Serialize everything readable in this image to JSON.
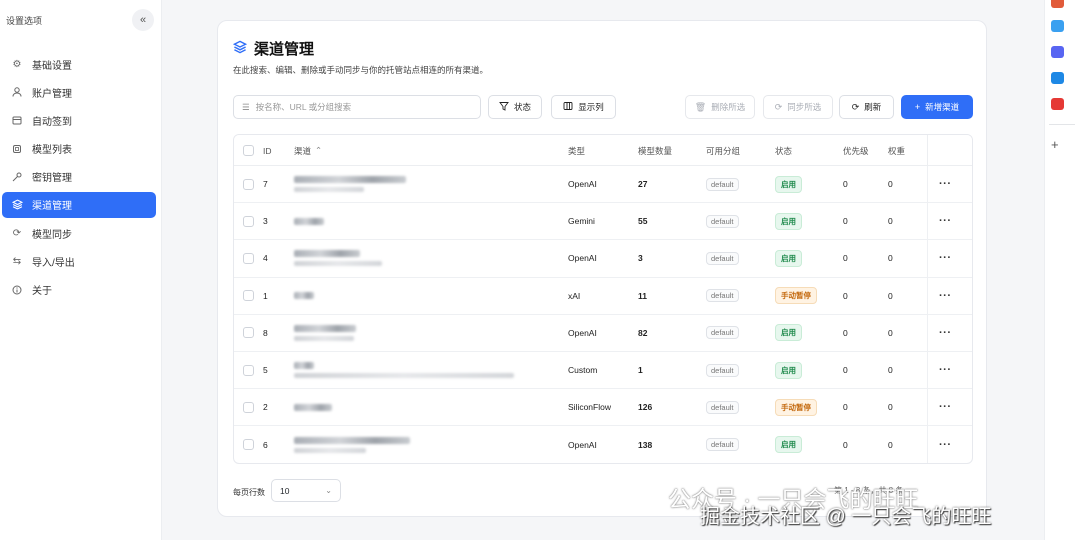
{
  "sidebar": {
    "title": "设置选项",
    "collapse_icon": "double-chevron-left-icon",
    "items": [
      {
        "label": "基础设置",
        "icon": "gear-icon"
      },
      {
        "label": "账户管理",
        "icon": "user-icon"
      },
      {
        "label": "自动签到",
        "icon": "calendar-icon"
      },
      {
        "label": "模型列表",
        "icon": "cube-icon"
      },
      {
        "label": "密钥管理",
        "icon": "key-icon"
      },
      {
        "label": "渠道管理",
        "icon": "layers-icon",
        "active": true
      },
      {
        "label": "模型同步",
        "icon": "sync-icon"
      },
      {
        "label": "导入/导出",
        "icon": "swap-icon"
      },
      {
        "label": "关于",
        "icon": "info-icon"
      }
    ]
  },
  "main": {
    "title": "渠道管理",
    "description": "在此搜索、编辑、删除或手动同步与你的托管站点相连的所有渠道。",
    "search_placeholder": "按名称、URL 或分组搜索",
    "buttons": {
      "status": "状态",
      "columns": "显示列",
      "delete_selected": "删除所选",
      "sync_selected": "同步所选",
      "refresh": "刷新",
      "add_channel": "新增渠道"
    },
    "columns": {
      "id": "ID",
      "channel": "渠道",
      "type": "类型",
      "model_count": "模型数量",
      "group": "可用分组",
      "status": "状态",
      "priority": "优先级",
      "weight": "权重"
    },
    "rows": [
      {
        "id": "7",
        "type": "OpenAI",
        "models": "27",
        "group": "default",
        "status": "启用",
        "status_kind": "ok",
        "priority": "0",
        "weight": "0"
      },
      {
        "id": "3",
        "type": "Gemini",
        "models": "55",
        "group": "default",
        "status": "启用",
        "status_kind": "ok",
        "priority": "0",
        "weight": "0"
      },
      {
        "id": "4",
        "type": "OpenAI",
        "models": "3",
        "group": "default",
        "status": "启用",
        "status_kind": "ok",
        "priority": "0",
        "weight": "0"
      },
      {
        "id": "1",
        "type": "xAI",
        "models": "11",
        "group": "default",
        "status": "手动暂停",
        "status_kind": "pause",
        "priority": "0",
        "weight": "0"
      },
      {
        "id": "8",
        "type": "OpenAI",
        "models": "82",
        "group": "default",
        "status": "启用",
        "status_kind": "ok",
        "priority": "0",
        "weight": "0"
      },
      {
        "id": "5",
        "type": "Custom",
        "models": "1",
        "group": "default",
        "status": "启用",
        "status_kind": "ok",
        "priority": "0",
        "weight": "0"
      },
      {
        "id": "2",
        "type": "SiliconFlow",
        "models": "126",
        "group": "default",
        "status": "手动暂停",
        "status_kind": "pause",
        "priority": "0",
        "weight": "0"
      },
      {
        "id": "6",
        "type": "OpenAI",
        "models": "138",
        "group": "default",
        "status": "启用",
        "status_kind": "ok",
        "priority": "0",
        "weight": "0"
      }
    ],
    "footer": {
      "rows_per_page_label": "每页行数",
      "rows_per_page_value": "10",
      "range_text": "第 1 - 8 条，共 8 条"
    }
  },
  "watermark": {
    "line1": "公众号 · 一只会飞的旺旺",
    "line2": "掘金技术社区 @ 一只会飞的旺旺"
  },
  "colors": {
    "accent": "#2f6ef7",
    "status_ok": "#1f8a4c",
    "status_pause": "#c46a10"
  }
}
